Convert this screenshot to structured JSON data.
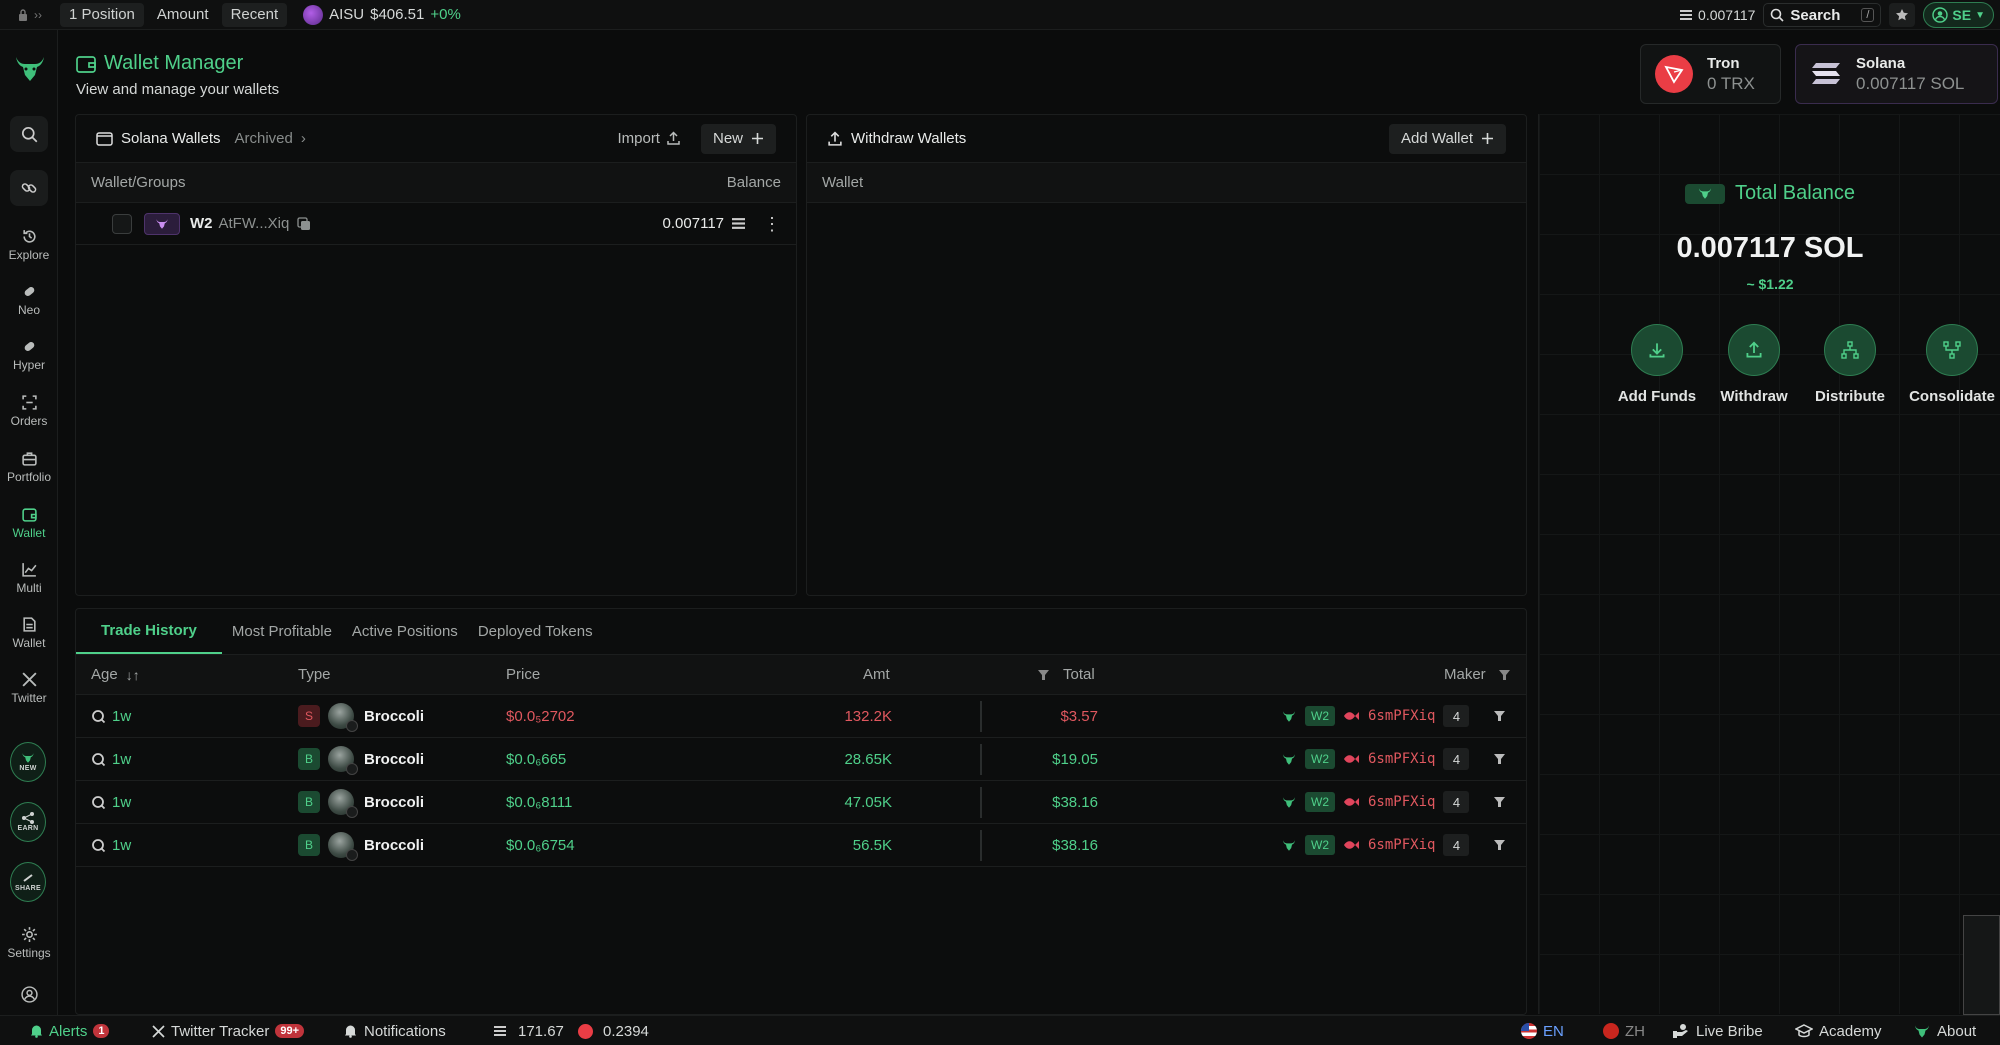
{
  "topbar": {
    "tabs": [
      "1 Position",
      "Amount",
      "Recent"
    ],
    "active_tab": 2,
    "ticker_symbol": "AISU",
    "ticker_price": "$406.51",
    "ticker_change": "+0%",
    "balance": "0.007117",
    "search_label": "Search",
    "search_shortcut": "/",
    "user_label": "SE"
  },
  "nav": {
    "items": [
      {
        "label": "Explore",
        "icon": "explore-icon"
      },
      {
        "label": "Neo",
        "icon": "neo-icon"
      },
      {
        "label": "Hyper",
        "icon": "hyper-icon"
      },
      {
        "label": "Orders",
        "icon": "orders-icon"
      },
      {
        "label": "Portfolio",
        "icon": "portfolio-icon"
      },
      {
        "label": "Wallet",
        "icon": "wallet-icon"
      },
      {
        "label": "Multi",
        "icon": "chart-icon"
      },
      {
        "label": "Wallet",
        "icon": "wallet-doc-icon"
      },
      {
        "label": "Twitter",
        "icon": "x-icon"
      }
    ],
    "promos": [
      "NEW",
      "EARN",
      "SHARE"
    ],
    "settings_label": "Settings"
  },
  "header": {
    "title": "Wallet Manager",
    "subtitle": "View and manage your wallets"
  },
  "chains": [
    {
      "name": "Tron",
      "value": "0 TRX"
    },
    {
      "name": "Solana",
      "value": "0.007117 SOL"
    }
  ],
  "solana_wallets": {
    "title": "Solana Wallets",
    "archived_label": "Archived",
    "import_label": "Import",
    "new_label": "New",
    "col_wallet": "Wallet/Groups",
    "col_balance": "Balance",
    "rows": [
      {
        "name": "W2",
        "address": "AtFW...Xiq",
        "balance": "0.007117"
      }
    ]
  },
  "withdraw_wallets": {
    "title": "Withdraw Wallets",
    "add_label": "Add Wallet",
    "col_wallet": "Wallet"
  },
  "total_balance": {
    "title": "Total Balance",
    "amount": "0.007117 SOL",
    "usd": "~ $1.22",
    "actions": [
      "Add Funds",
      "Withdraw",
      "Distribute",
      "Consolidate"
    ]
  },
  "trade_history": {
    "tabs": [
      "Trade History",
      "Most Profitable",
      "Active Positions",
      "Deployed Tokens"
    ],
    "columns": {
      "age": "Age",
      "type": "Type",
      "price": "Price",
      "amt": "Amt",
      "total": "Total",
      "maker": "Maker"
    },
    "rows": [
      {
        "age": "1w",
        "side": "S",
        "token": "Broccoli",
        "price": "$0.0₅2702",
        "amt": "132.2K",
        "total": "$3.57",
        "wallet": "W2",
        "maker": "6smPFXiq",
        "count": "4"
      },
      {
        "age": "1w",
        "side": "B",
        "token": "Broccoli",
        "price": "$0.0₆665",
        "amt": "28.65K",
        "total": "$19.05",
        "wallet": "W2",
        "maker": "6smPFXiq",
        "count": "4"
      },
      {
        "age": "1w",
        "side": "B",
        "token": "Broccoli",
        "price": "$0.0₆8111",
        "amt": "47.05K",
        "total": "$38.16",
        "wallet": "W2",
        "maker": "6smPFXiq",
        "count": "4"
      },
      {
        "age": "1w",
        "side": "B",
        "token": "Broccoli",
        "price": "$0.0₆6754",
        "amt": "56.5K",
        "total": "$38.16",
        "wallet": "W2",
        "maker": "6smPFXiq",
        "count": "4"
      }
    ]
  },
  "bottombar": {
    "alerts_label": "Alerts",
    "alerts_count": "1",
    "twitter_label": "Twitter Tracker",
    "twitter_count": "99+",
    "notifications_label": "Notifications",
    "sol_price": "171.67",
    "other_price": "0.2394",
    "lang_en": "EN",
    "lang_zh": "ZH",
    "live_bribe": "Live Bribe",
    "academy": "Academy",
    "about": "About"
  },
  "colors": {
    "accent": "#4fd08a",
    "sell": "#e0585f",
    "background": "#0b0c0c"
  }
}
